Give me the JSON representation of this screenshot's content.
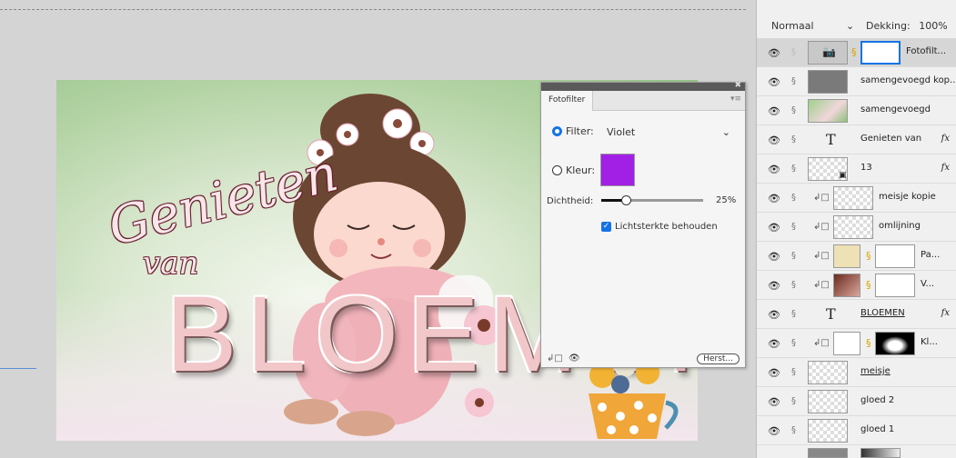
{
  "canvas": {
    "script_line1": "Genieten",
    "script_line2": "van",
    "big_text": "BLOEMEN"
  },
  "dialog": {
    "tab": "Fotofilter",
    "filter_label": "Filter:",
    "filter_value": "Violet",
    "color_label": "Kleur:",
    "color_swatch": "#a21fe6",
    "density_label": "Dichtheid:",
    "density_value": "25%",
    "preserve_label": "Lichtsterkte behouden",
    "reset_button": "Herst..."
  },
  "layers_panel": {
    "blend_mode": "Normaal",
    "opacity_label": "Dekking:",
    "opacity_value": "100%",
    "layers": [
      {
        "name": "Fotofilt..."
      },
      {
        "name": "samengevoegd kop..."
      },
      {
        "name": "samengevoegd"
      },
      {
        "name": "Genieten van",
        "fx": "fx"
      },
      {
        "name": "13",
        "fx": "fx"
      },
      {
        "name": "meisje kopie"
      },
      {
        "name": "omlijning"
      },
      {
        "name": "Pa..."
      },
      {
        "name": "V..."
      },
      {
        "name": "BLOEMEN",
        "fx": "fx"
      },
      {
        "name": "Kl..."
      },
      {
        "name": "meisje "
      },
      {
        "name": "gloed 2"
      },
      {
        "name": "gloed 1"
      }
    ]
  }
}
